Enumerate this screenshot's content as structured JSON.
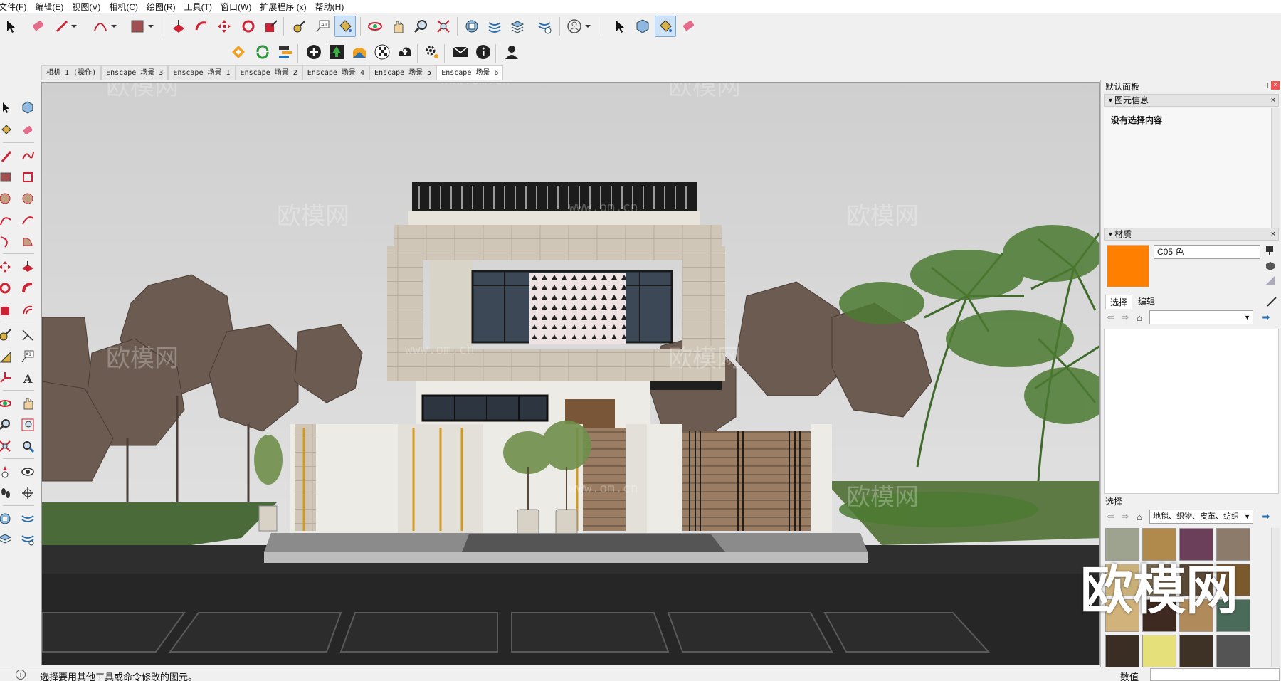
{
  "menu": [
    "文件(F)",
    "编辑(E)",
    "视图(V)",
    "相机(C)",
    "绘图(R)",
    "工具(T)",
    "窗口(W)",
    "扩展程序 (x)",
    "帮助(H)"
  ],
  "tabs": [
    "相机 1 (操作)",
    "Enscape 场景 3",
    "Enscape 场景 1",
    "Enscape 场景 2",
    "Enscape 场景 4",
    "Enscape 场景 5",
    "Enscape 场景 6"
  ],
  "toolbar_icons": [
    "select-icon",
    "eraser-icon",
    "pencil-icon",
    "arc-icon",
    "rectangle-icon",
    "push-pull-icon",
    "follow-me-icon",
    "move-icon",
    "rotate-icon",
    "scale-icon",
    "tape-measure-icon",
    "text-icon",
    "paint-bucket-icon",
    "orbit-icon",
    "pan-icon",
    "zoom-icon",
    "zoom-extents-icon",
    "warehouse-icon",
    "extension-warehouse-icon",
    "layout-icon",
    "extension-manager-icon",
    "profile-icon",
    "select-icon",
    "component-icon",
    "paint-bucket-icon",
    "eraser-icon"
  ],
  "toolbar2_icons": [
    "enscape-start-icon",
    "enscape-sync-icon",
    "enscape-views-icon",
    "enscape-add-icon",
    "enscape-asset-library-icon",
    "enscape-material-icon",
    "enscape-checker-icon",
    "enscape-upload-icon",
    "enscape-settings-icon",
    "enscape-feedback-icon",
    "enscape-info-icon",
    "enscape-account-icon"
  ],
  "panel": {
    "title": "默认面板",
    "entity_info": {
      "heading": "图元信息",
      "no_selection": "没有选择内容"
    },
    "materials": {
      "heading": "材质",
      "current_name": "C05 色",
      "current_color": "#ff8000",
      "tab_select": "选择",
      "tab_edit": "编辑",
      "dropdown_value": "",
      "select_label": "选择",
      "library_dropdown": "地毯、织物、皮革、纺织",
      "swatches": [
        "#9ea38f",
        "#b08a4c",
        "#6b3f5a",
        "#8c7a6a",
        "#c9b07a",
        "#7a6a50",
        "#5c4a38",
        "#7a5a2c",
        "#d1b27a",
        "#3e2a20",
        "#b08a5a",
        "#4a6a5a",
        "#3a2e24",
        "#e6e07a",
        "#3e3126",
        "#545454"
      ]
    }
  },
  "status": {
    "message": "选择要用其他工具或命令修改的图元。",
    "value_label": "数值",
    "value": ""
  },
  "watermarks": {
    "text": "欧模网",
    "url": "www.om.cn"
  }
}
